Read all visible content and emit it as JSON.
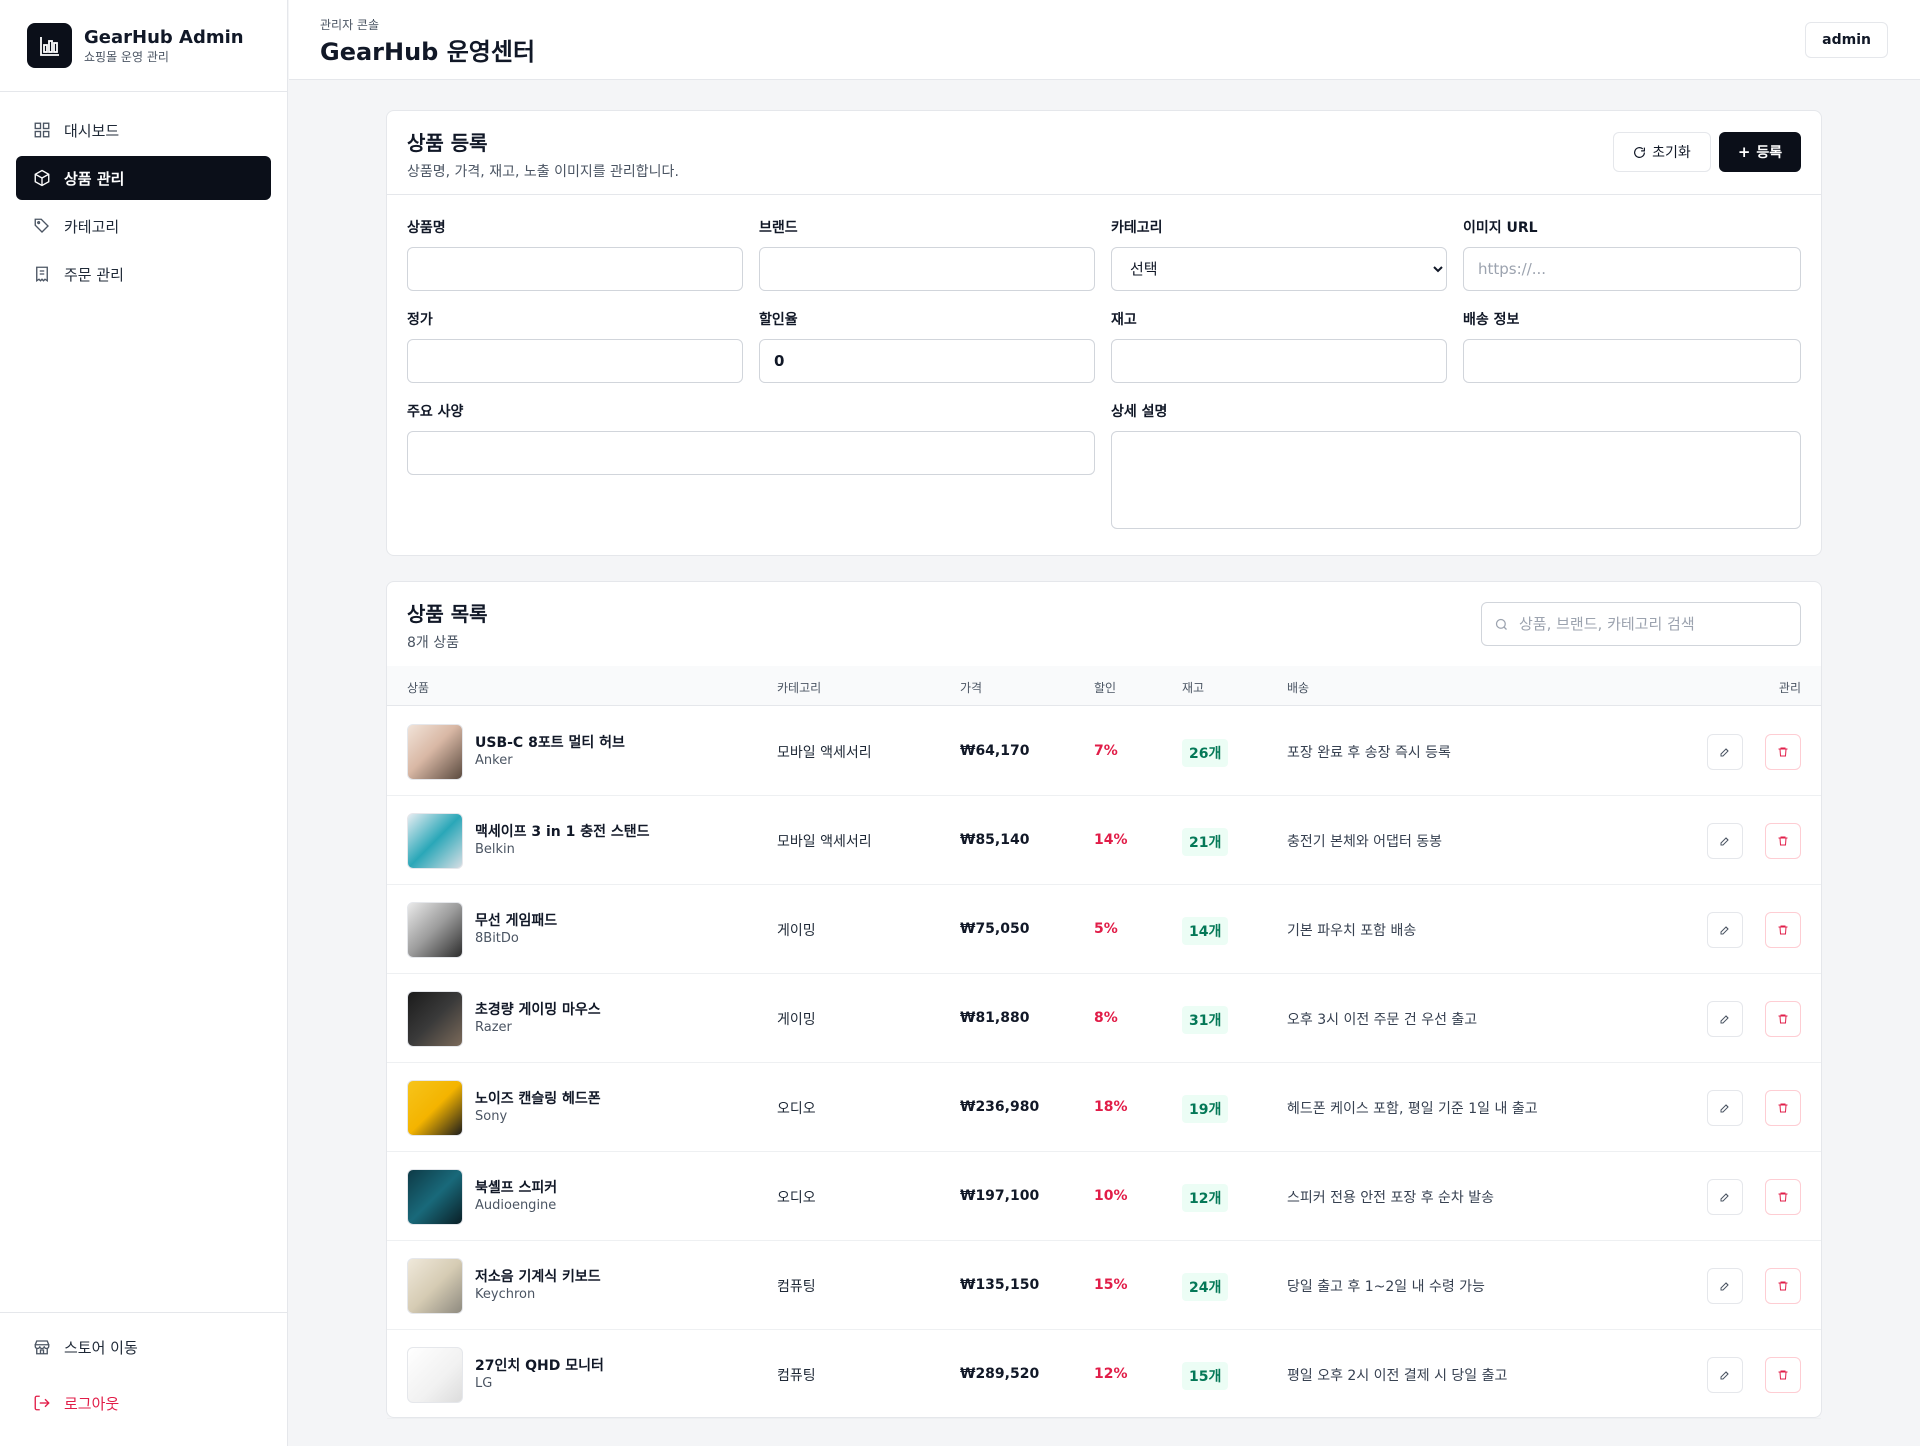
{
  "brand": {
    "title": "GearHub Admin",
    "subtitle": "쇼핑몰 운영 관리"
  },
  "nav": [
    {
      "label": "대시보드",
      "icon": "grid-icon"
    },
    {
      "label": "상품 관리",
      "icon": "box-icon",
      "active": true
    },
    {
      "label": "카테고리",
      "icon": "tag-icon"
    },
    {
      "label": "주문 관리",
      "icon": "receipt-icon"
    }
  ],
  "sidebar_bottom": {
    "store": "스토어 이동",
    "logout": "로그아웃"
  },
  "header": {
    "breadcrumb": "관리자 콘솔",
    "title": "GearHub 운영센터",
    "user": "admin"
  },
  "form": {
    "title": "상품 등록",
    "subtitle": "상품명, 가격, 재고, 노출 이미지를 관리합니다.",
    "reset_label": "초기화",
    "register_label": "등록",
    "labels": {
      "name": "상품명",
      "brand": "브랜드",
      "category": "카테고리",
      "image": "이미지 URL",
      "price": "정가",
      "discount": "할인율",
      "stock": "재고",
      "shipping": "배송 정보",
      "specs": "주요 사양",
      "description": "상세 설명"
    },
    "values": {
      "name": "",
      "brand": "",
      "category": "선택",
      "image": "",
      "price": "",
      "discount": "0",
      "stock": "",
      "shipping": "",
      "specs": "",
      "description": ""
    },
    "placeholders": {
      "image": "https://..."
    }
  },
  "list": {
    "title": "상품 목록",
    "count": "8개 상품",
    "search_placeholder": "상품, 브랜드, 카테고리 검색",
    "columns": {
      "product": "상품",
      "category": "카테고리",
      "price": "가격",
      "discount": "할인",
      "stock": "재고",
      "shipping": "배송",
      "manage": "관리"
    },
    "rows": [
      {
        "name": "USB-C 8포트 멀티 허브",
        "brand": "Anker",
        "category": "모바일 액세서리",
        "price": "₩64,170",
        "discount": "7%",
        "stock": "26개",
        "shipping": "포장 완료 후 송장 즉시 등록"
      },
      {
        "name": "맥세이프 3 in 1 충전 스탠드",
        "brand": "Belkin",
        "category": "모바일 액세서리",
        "price": "₩85,140",
        "discount": "14%",
        "stock": "21개",
        "shipping": "충전기 본체와 어댑터 동봉"
      },
      {
        "name": "무선 게임패드",
        "brand": "8BitDo",
        "category": "게이밍",
        "price": "₩75,050",
        "discount": "5%",
        "stock": "14개",
        "shipping": "기본 파우치 포함 배송"
      },
      {
        "name": "초경량 게이밍 마우스",
        "brand": "Razer",
        "category": "게이밍",
        "price": "₩81,880",
        "discount": "8%",
        "stock": "31개",
        "shipping": "오후 3시 이전 주문 건 우선 출고"
      },
      {
        "name": "노이즈 캔슬링 헤드폰",
        "brand": "Sony",
        "category": "오디오",
        "price": "₩236,980",
        "discount": "18%",
        "stock": "19개",
        "shipping": "헤드폰 케이스 포함, 평일 기준 1일 내 출고"
      },
      {
        "name": "북셸프 스피커",
        "brand": "Audioengine",
        "category": "오디오",
        "price": "₩197,100",
        "discount": "10%",
        "stock": "12개",
        "shipping": "스피커 전용 안전 포장 후 순차 발송"
      },
      {
        "name": "저소음 기계식 키보드",
        "brand": "Keychron",
        "category": "컴퓨팅",
        "price": "₩135,150",
        "discount": "15%",
        "stock": "24개",
        "shipping": "당일 출고 후 1~2일 내 수령 가능"
      },
      {
        "name": "27인치 QHD 모니터",
        "brand": "LG",
        "category": "컴퓨팅",
        "price": "₩289,520",
        "discount": "12%",
        "stock": "15개",
        "shipping": "평일 오후 2시 이전 결제 시 당일 출고"
      }
    ]
  },
  "colors": {
    "primary": "#0b0f19",
    "danger": "#e11d48",
    "stock_bg": "#ecfdf5",
    "stock_text": "#047857"
  }
}
